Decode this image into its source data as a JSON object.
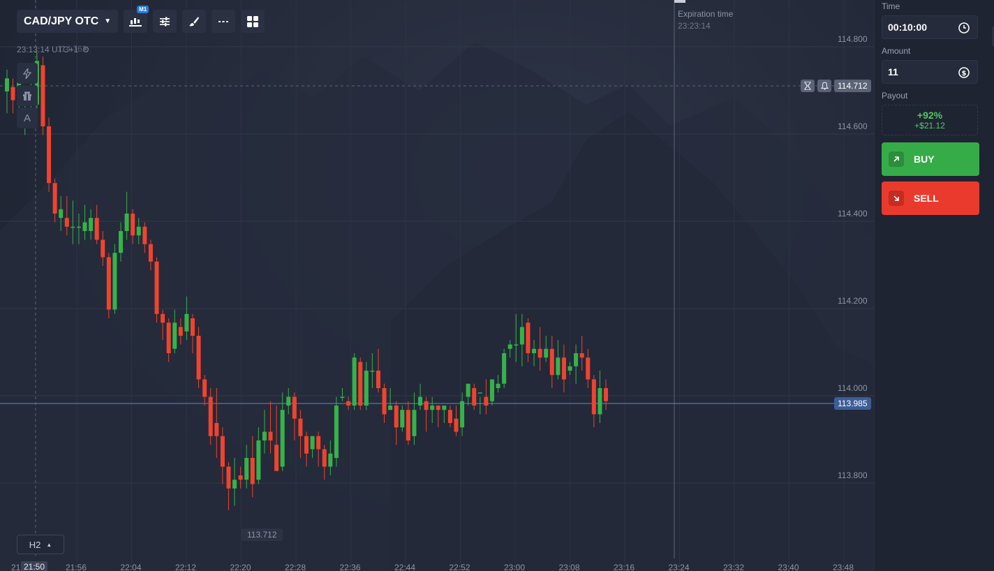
{
  "toolbar": {
    "pair": "CAD/JPY OTC",
    "timeframe_badge": "M1",
    "tools": [
      "chart-type-icon",
      "settings-sliders-icon",
      "brush-icon",
      "line-tool-icon",
      "grid-layout-icon"
    ]
  },
  "clock": {
    "time": "23:13:14 UTC+1",
    "ghost_price": "114.762"
  },
  "side_tools": [
    "lightning-icon",
    "gift-icon",
    "A"
  ],
  "expiration": {
    "label": "Expiration time",
    "time": "23:23:14"
  },
  "price_tags": {
    "line_price": "114.712",
    "current_price": "113.985"
  },
  "low_label": "113.712",
  "timeframe": "H2",
  "x_current": "21:50",
  "x_first_partial": "21",
  "colors": {
    "up": "#35b34a",
    "down": "#f0432f",
    "buy": "#36ac48",
    "sell": "#ea3a2e",
    "price_line": "#5b8ad6"
  },
  "chart_data": {
    "type": "candlestick",
    "y_ticks": [
      "114.800",
      "114.600",
      "114.400",
      "114.200",
      "114.000",
      "113.800"
    ],
    "ylim": [
      113.7,
      114.88
    ],
    "x_ticks": [
      "21:56",
      "22:04",
      "22:12",
      "22:20",
      "22:28",
      "22:36",
      "22:44",
      "22:52",
      "23:00",
      "23:08",
      "23:16",
      "23:24",
      "23:32",
      "23:40",
      "23:48"
    ],
    "candles": [
      [
        114.68,
        114.71,
        114.63,
        114.73
      ],
      [
        114.69,
        114.66,
        114.63,
        114.71
      ],
      [
        114.65,
        114.7,
        114.62,
        114.73
      ],
      [
        114.66,
        114.66,
        114.58,
        114.69
      ],
      [
        114.65,
        114.66,
        114.61,
        114.71
      ],
      [
        114.65,
        114.75,
        114.62,
        114.77
      ],
      [
        114.74,
        114.6,
        114.58,
        114.76
      ],
      [
        114.6,
        114.47,
        114.45,
        114.62
      ],
      [
        114.47,
        114.4,
        114.38,
        114.48
      ],
      [
        114.39,
        114.41,
        114.36,
        114.44
      ],
      [
        114.39,
        114.37,
        114.35,
        114.44
      ],
      [
        114.37,
        114.37,
        114.33,
        114.43
      ],
      [
        114.37,
        114.37,
        114.33,
        114.4
      ],
      [
        114.36,
        114.38,
        114.34,
        114.42
      ],
      [
        114.36,
        114.39,
        114.34,
        114.41
      ],
      [
        114.39,
        114.34,
        114.33,
        114.42
      ],
      [
        114.34,
        114.3,
        114.28,
        114.36
      ],
      [
        114.3,
        114.18,
        114.16,
        114.31
      ],
      [
        114.18,
        114.31,
        114.17,
        114.33
      ],
      [
        114.31,
        114.36,
        114.29,
        114.38
      ],
      [
        114.36,
        114.4,
        114.34,
        114.45
      ],
      [
        114.4,
        114.35,
        114.33,
        114.41
      ],
      [
        114.35,
        114.37,
        114.33,
        114.39
      ],
      [
        114.37,
        114.33,
        114.31,
        114.38
      ],
      [
        114.33,
        114.29,
        114.27,
        114.34
      ],
      [
        114.29,
        114.17,
        114.15,
        114.3
      ],
      [
        114.17,
        114.15,
        114.11,
        114.18
      ],
      [
        114.15,
        114.08,
        114.06,
        114.16
      ],
      [
        114.09,
        114.15,
        114.08,
        114.18
      ],
      [
        114.14,
        114.12,
        114.1,
        114.16
      ],
      [
        114.13,
        114.17,
        114.11,
        114.21
      ],
      [
        114.16,
        114.12,
        114.08,
        114.17
      ],
      [
        114.12,
        114.02,
        114.0,
        114.14
      ],
      [
        114.02,
        113.98,
        113.96,
        114.03
      ],
      [
        113.98,
        113.89,
        113.87,
        114.0
      ],
      [
        113.92,
        113.89,
        113.84,
        114.0
      ],
      [
        113.89,
        113.82,
        113.78,
        113.91
      ],
      [
        113.82,
        113.77,
        113.72,
        113.83
      ],
      [
        113.77,
        113.79,
        113.73,
        113.84
      ],
      [
        113.8,
        113.79,
        113.77,
        113.82
      ],
      [
        113.79,
        113.84,
        113.77,
        113.87
      ],
      [
        113.84,
        113.78,
        113.75,
        113.89
      ],
      [
        113.79,
        113.88,
        113.78,
        113.91
      ],
      [
        113.88,
        113.9,
        113.85,
        113.95
      ],
      [
        113.9,
        113.88,
        113.85,
        113.97
      ],
      [
        113.87,
        113.81,
        113.81,
        113.96
      ],
      [
        113.82,
        113.95,
        113.81,
        113.99
      ],
      [
        113.96,
        113.98,
        113.94,
        114.0
      ],
      [
        113.98,
        113.93,
        113.88,
        113.99
      ],
      [
        113.93,
        113.89,
        113.84,
        113.95
      ],
      [
        113.89,
        113.85,
        113.82,
        113.9
      ],
      [
        113.86,
        113.89,
        113.84,
        113.89
      ],
      [
        113.89,
        113.86,
        113.82,
        113.9
      ],
      [
        113.86,
        113.82,
        113.79,
        113.87
      ],
      [
        113.82,
        113.85,
        113.8,
        113.88
      ],
      [
        113.84,
        113.96,
        113.82,
        113.98
      ],
      [
        113.98,
        113.98,
        113.97,
        114.0
      ],
      [
        113.97,
        113.96,
        113.95,
        113.98
      ],
      [
        113.96,
        114.07,
        113.95,
        114.08
      ],
      [
        114.06,
        113.96,
        113.95,
        114.07
      ],
      [
        113.96,
        114.04,
        113.95,
        114.06
      ],
      [
        114.04,
        114.04,
        114.0,
        114.08
      ],
      [
        114.04,
        114.0,
        113.99,
        114.09
      ],
      [
        114.0,
        113.94,
        113.92,
        114.01
      ],
      [
        113.95,
        113.96,
        113.96,
        114.0
      ],
      [
        113.96,
        113.91,
        113.87,
        113.97
      ],
      [
        113.91,
        113.95,
        113.9,
        113.96
      ],
      [
        113.95,
        113.88,
        113.87,
        113.97
      ],
      [
        113.89,
        113.95,
        113.87,
        113.99
      ],
      [
        113.96,
        113.98,
        113.95,
        114.01
      ],
      [
        113.97,
        113.95,
        113.9,
        113.98
      ],
      [
        113.95,
        113.96,
        113.92,
        113.98
      ],
      [
        113.96,
        113.95,
        113.91,
        113.96
      ],
      [
        113.95,
        113.96,
        113.92,
        113.96
      ],
      [
        113.95,
        113.92,
        113.91,
        113.96
      ],
      [
        113.93,
        113.9,
        113.89,
        113.96
      ],
      [
        113.91,
        113.97,
        113.89,
        113.99
      ],
      [
        113.98,
        114.01,
        113.96,
        114.01
      ],
      [
        114.0,
        113.96,
        113.95,
        114.01
      ],
      [
        113.99,
        113.99,
        113.94,
        113.98
      ],
      [
        113.98,
        113.96,
        113.94,
        114.02
      ],
      [
        113.97,
        114.02,
        113.96,
        114.02
      ],
      [
        114.0,
        114.01,
        113.99,
        114.03
      ],
      [
        114.01,
        114.08,
        114.0,
        114.09
      ],
      [
        114.09,
        114.1,
        114.07,
        114.11
      ],
      [
        114.1,
        114.1,
        114.06,
        114.17
      ],
      [
        114.1,
        114.14,
        114.05,
        114.17
      ],
      [
        114.15,
        114.08,
        114.06,
        114.16
      ],
      [
        114.08,
        114.09,
        114.05,
        114.11
      ],
      [
        114.09,
        114.07,
        114.04,
        114.14
      ],
      [
        114.07,
        114.09,
        114.06,
        114.12
      ],
      [
        114.09,
        114.03,
        114.0,
        114.12
      ],
      [
        114.03,
        114.07,
        114.02,
        114.11
      ],
      [
        114.07,
        114.02,
        113.99,
        114.1
      ],
      [
        114.04,
        114.05,
        114.03,
        114.06
      ],
      [
        114.05,
        114.08,
        114.01,
        114.1
      ],
      [
        114.08,
        114.07,
        114.04,
        114.12
      ],
      [
        114.07,
        114.02,
        114.0,
        114.09
      ],
      [
        114.02,
        113.94,
        113.91,
        114.03
      ],
      [
        113.94,
        114.0,
        113.92,
        114.04
      ],
      [
        114.0,
        113.97,
        113.95,
        114.02
      ]
    ]
  },
  "panel": {
    "time_label": "Time",
    "time_value": "00:10:00",
    "amount_label": "Amount",
    "amount_value": "11",
    "payout_label": "Payout",
    "payout_pct": "+92%",
    "payout_amt": "+$21.12",
    "buy_label": "BUY",
    "sell_label": "SELL"
  }
}
